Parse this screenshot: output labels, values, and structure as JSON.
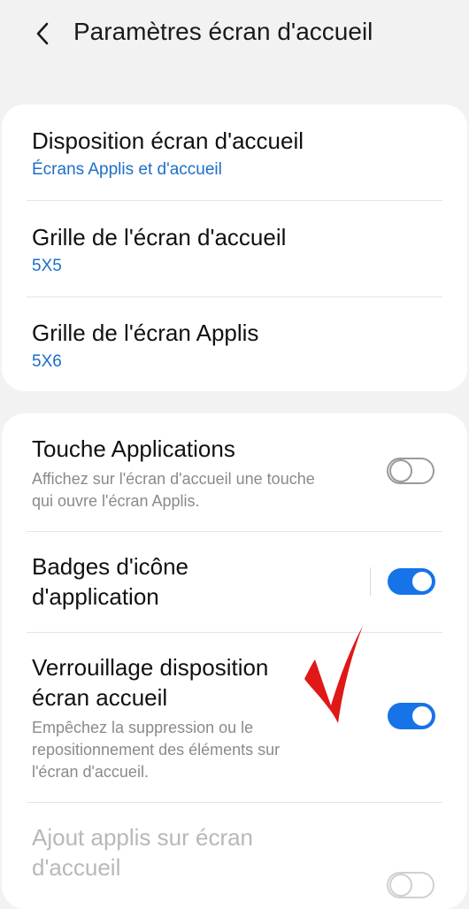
{
  "header": {
    "back_icon": "chevron-left-icon",
    "title": "Paramètres écran d'accueil"
  },
  "card1": {
    "items": [
      {
        "title": "Disposition écran d'accueil",
        "value": "Écrans Applis et d'accueil"
      },
      {
        "title": "Grille de l'écran d'accueil",
        "value": "5X5"
      },
      {
        "title": "Grille de l'écran Applis",
        "value": "5X6"
      }
    ]
  },
  "card2": {
    "items": [
      {
        "title": "Touche Applications",
        "desc_line1": "Affichez sur l'écran d'accueil une touche",
        "desc_line2": "qui ouvre l'écran Applis.",
        "toggle": "off"
      },
      {
        "title_line1": "Badges d'icône",
        "title_line2": "d'application",
        "toggle": "on"
      },
      {
        "title_line1": "Verrouillage disposition",
        "title_line2": "écran accueil",
        "desc_line1": "Empêchez la suppression ou le",
        "desc_line2": "repositionnement des éléments sur",
        "desc_line3": "l'écran d'accueil.",
        "toggle": "on"
      },
      {
        "title_line1": "Ajout applis sur écran",
        "title_line2": "d'accueil",
        "toggle": "off",
        "disabled": true
      }
    ]
  },
  "colors": {
    "accent": "#1773e8",
    "link_blue": "#1c6fc9",
    "annotation_red": "#e01818",
    "background": "#f2f2f2"
  }
}
